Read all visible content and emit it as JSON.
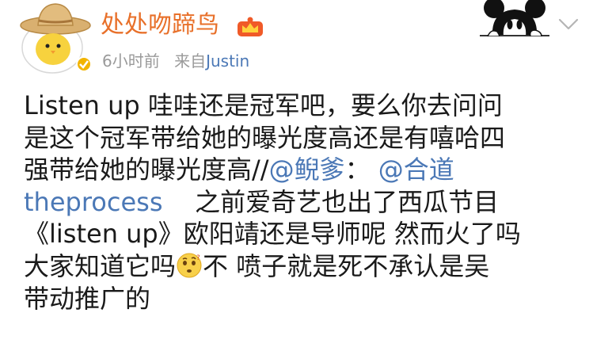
{
  "post": {
    "author": {
      "name": "处处吻蹄鸟",
      "avatar_icon": "sally-chick-straw-hat-icon",
      "verified_icon": "verified-badge-icon",
      "vip_icon": "weibo-vip-crown-icon"
    },
    "time": "6小时前",
    "source_prefix": "来自",
    "source_client": "Justin",
    "top_right_icon": "mickey-mouse-peeking-icon",
    "menu_icon": "chevron-down-icon",
    "body": {
      "line1": "Listen up 哇哇还是冠军吧，要么你去问问",
      "line2": "是这个冠军带给她的曝光度高还是有嘻哈四",
      "line3_text": "强带给她的曝光度高//",
      "line3_mention1": "@鲵爹",
      "line3_colon": "：",
      "line3_mention2": "@合道",
      "line4_mention": "theprocess",
      "line4_text": "之前爱奇艺也出了西瓜节目",
      "line5": "《listen up》欧阳靖还是导师呢 然而火了吗",
      "line6_before": "大家知道它吗",
      "line6_emoji": "thinking-face-icon",
      "line6_after": "不 喷子就是死不承认是吴",
      "line7": "带动推广的"
    },
    "colors": {
      "username": "#e8702a",
      "mention": "#4b78b6",
      "meta": "#9a9a9a",
      "text": "#1a1a1a"
    }
  }
}
